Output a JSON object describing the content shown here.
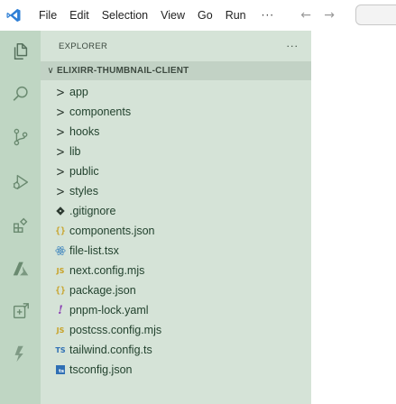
{
  "colors": {
    "activitybar_bg": "#bfd6c3",
    "sidebar_bg": "#d5e3d7",
    "root_folder_bg": "#c2d2c5",
    "vscode_blue": "#2f7fd6"
  },
  "menubar": {
    "logo_icon": "vscode-logo-icon",
    "items": [
      "File",
      "Edit",
      "Selection",
      "View",
      "Go",
      "Run"
    ],
    "more": "···",
    "back_icon": "arrow-left-icon",
    "forward_icon": "arrow-right-icon",
    "back_glyph": "←",
    "forward_glyph": "→"
  },
  "activitybar": {
    "items": [
      {
        "icon": "explorer-files-icon"
      },
      {
        "icon": "search-icon"
      },
      {
        "icon": "source-control-icon"
      },
      {
        "icon": "run-debug-icon"
      },
      {
        "icon": "extensions-icon"
      },
      {
        "icon": "azure-icon"
      },
      {
        "icon": "remote-explorer-icon"
      },
      {
        "icon": "deploy-icon"
      }
    ]
  },
  "sidebar": {
    "title": "EXPLORER",
    "more": "···",
    "root_folder": {
      "chevron": "∨",
      "label": "ELIXIRR-THUMBNAIL-CLIENT"
    },
    "folders": [
      {
        "label": "app",
        "chevron": ">"
      },
      {
        "label": "components",
        "chevron": ">"
      },
      {
        "label": "hooks",
        "chevron": ">"
      },
      {
        "label": "lib",
        "chevron": ">"
      },
      {
        "label": "public",
        "chevron": ">"
      },
      {
        "label": "styles",
        "chevron": ">"
      }
    ],
    "files": [
      {
        "label": ".gitignore",
        "icon": "git-diamond-icon"
      },
      {
        "label": "components.json",
        "icon": "json-braces-icon",
        "glyph": "{}"
      },
      {
        "label": "file-list.tsx",
        "icon": "react-atom-icon"
      },
      {
        "label": "next.config.mjs",
        "icon": "javascript-icon",
        "glyph": "JS"
      },
      {
        "label": "package.json",
        "icon": "json-braces-icon",
        "glyph": "{}"
      },
      {
        "label": "pnpm-lock.yaml",
        "icon": "yaml-exclamation-icon",
        "glyph": "!"
      },
      {
        "label": "postcss.config.mjs",
        "icon": "javascript-icon",
        "glyph": "JS"
      },
      {
        "label": "tailwind.config.ts",
        "icon": "typescript-icon",
        "glyph": "TS"
      },
      {
        "label": "tsconfig.json",
        "icon": "tsconfig-icon",
        "glyph": "ts"
      }
    ]
  }
}
